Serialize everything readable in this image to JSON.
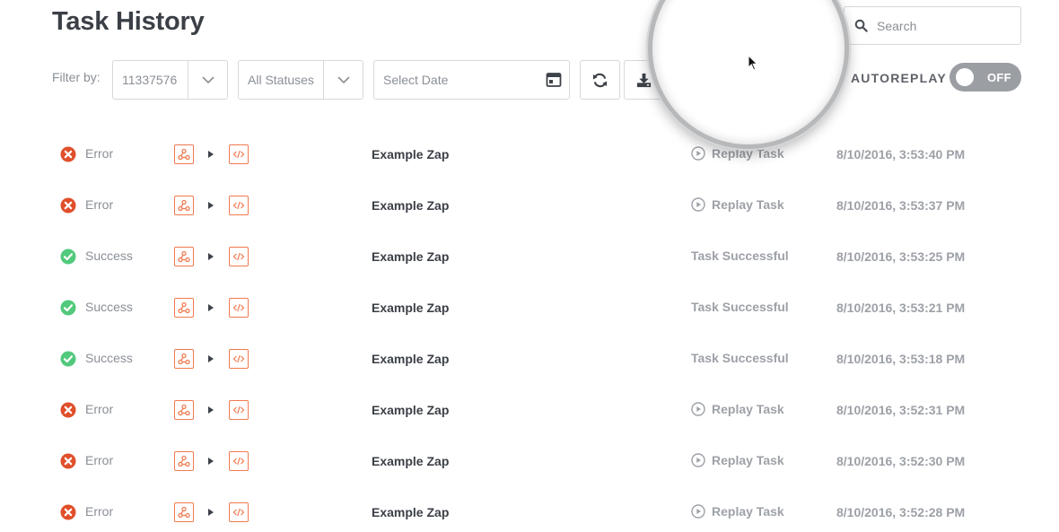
{
  "header": {
    "title": "Task History"
  },
  "search": {
    "placeholder": "Search",
    "icon": "search-icon"
  },
  "filters": {
    "label": "Filter by:",
    "zap_id": "11337576",
    "status": "All Statuses",
    "date_placeholder": "Select Date"
  },
  "autoreplay": {
    "label": "AUTOREPLAY",
    "state": "OFF"
  },
  "colors": {
    "error": "#e04f2b",
    "success": "#52c97c",
    "app_accent": "#f07a4f",
    "toggle_off": "#9b9ea3"
  },
  "tasks": [
    {
      "status": "Error",
      "zap": "Example Zap",
      "action": "Replay Task",
      "time": "8/10/2016, 3:53:40 PM"
    },
    {
      "status": "Error",
      "zap": "Example Zap",
      "action": "Replay Task",
      "time": "8/10/2016, 3:53:37 PM"
    },
    {
      "status": "Success",
      "zap": "Example Zap",
      "action": "Task Successful",
      "time": "8/10/2016, 3:53:25 PM"
    },
    {
      "status": "Success",
      "zap": "Example Zap",
      "action": "Task Successful",
      "time": "8/10/2016, 3:53:21 PM"
    },
    {
      "status": "Success",
      "zap": "Example Zap",
      "action": "Task Successful",
      "time": "8/10/2016, 3:53:18 PM"
    },
    {
      "status": "Error",
      "zap": "Example Zap",
      "action": "Replay Task",
      "time": "8/10/2016, 3:52:31 PM"
    },
    {
      "status": "Error",
      "zap": "Example Zap",
      "action": "Replay Task",
      "time": "8/10/2016, 3:52:30 PM"
    },
    {
      "status": "Error",
      "zap": "Example Zap",
      "action": "Replay Task",
      "time": "8/10/2016, 3:52:28 PM"
    }
  ]
}
